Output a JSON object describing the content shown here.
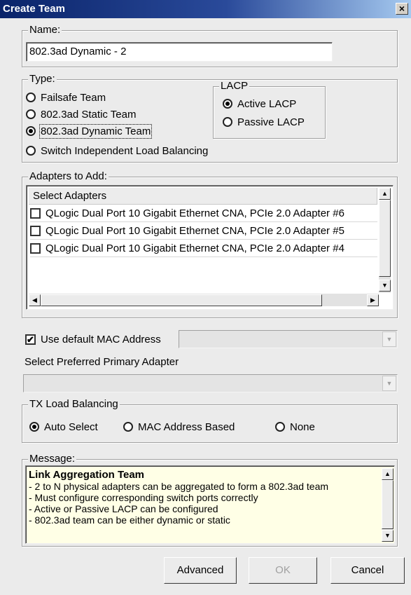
{
  "window": {
    "title": "Create Team",
    "close_label": "×"
  },
  "name_group": {
    "legend": "Name:",
    "value": "802.3ad Dynamic - 2"
  },
  "type_group": {
    "legend": "Type:",
    "options": [
      {
        "label": "Failsafe Team",
        "selected": false
      },
      {
        "label": "802.3ad Static Team",
        "selected": false
      },
      {
        "label": "802.3ad Dynamic Team",
        "selected": true
      },
      {
        "label": "Switch Independent Load Balancing",
        "selected": false
      }
    ]
  },
  "lacp_group": {
    "legend": "LACP",
    "options": [
      {
        "label": "Active LACP",
        "selected": true
      },
      {
        "label": "Passive LACP",
        "selected": false
      }
    ]
  },
  "adapters_group": {
    "legend": "Adapters to Add:",
    "header": "Select Adapters",
    "rows": [
      {
        "label": "QLogic Dual Port 10 Gigabit Ethernet CNA, PCIe 2.0 Adapter #6",
        "checked": false
      },
      {
        "label": "QLogic Dual Port 10 Gigabit Ethernet CNA, PCIe 2.0 Adapter #5",
        "checked": false
      },
      {
        "label": "QLogic Dual Port 10 Gigabit Ethernet CNA, PCIe 2.0 Adapter #4",
        "checked": false
      }
    ]
  },
  "mac": {
    "label": "Use default MAC Address",
    "checked": true,
    "value": ""
  },
  "primary": {
    "label": "Select Preferred Primary Adapter",
    "value": ""
  },
  "tx_group": {
    "legend": "TX Load Balancing",
    "options": [
      {
        "label": "Auto Select",
        "selected": true
      },
      {
        "label": "MAC Address Based",
        "selected": false
      },
      {
        "label": "None",
        "selected": false
      }
    ]
  },
  "message_group": {
    "legend": "Message:",
    "title": "Link Aggregation Team",
    "lines": [
      "- 2 to N physical adapters can be aggregated to form a 802.3ad team",
      "- Must configure corresponding switch ports correctly",
      "- Active or Passive LACP can be configured",
      "- 802.3ad team can be either dynamic or static"
    ]
  },
  "buttons": {
    "advanced": "Advanced",
    "ok": "OK",
    "cancel": "Cancel"
  },
  "icons": {
    "check": "✔",
    "up": "▲",
    "down": "▼",
    "left": "◀",
    "right": "▶"
  }
}
